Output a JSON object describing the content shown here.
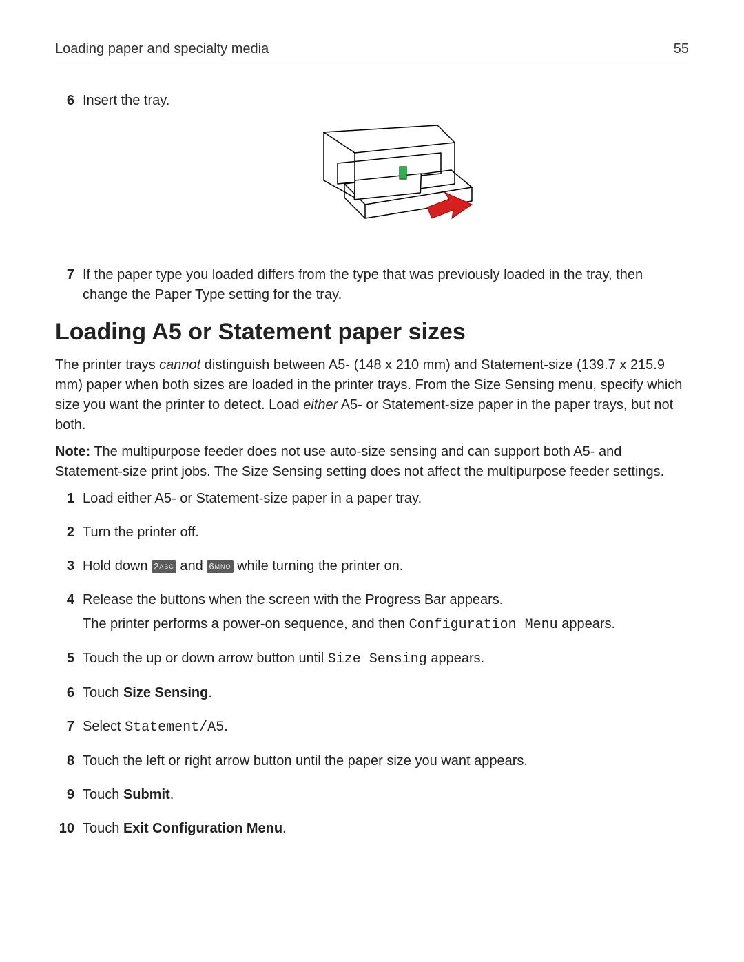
{
  "header": {
    "title": "Loading paper and specialty media",
    "page_number": "55"
  },
  "top_steps": {
    "s6": {
      "num": "6",
      "text": "Insert the tray."
    },
    "s7": {
      "num": "7",
      "text": "If the paper type you loaded differs from the type that was previously loaded in the tray, then change the Paper Type setting for the tray."
    }
  },
  "section": {
    "heading": "Loading A5 or Statement paper sizes",
    "p1_a": "The printer trays ",
    "p1_cannot": "cannot",
    "p1_b": " distinguish between A5‑ (148 x 210 mm) and Statement‑size (139.7 x 215.9 mm) paper when both sizes are loaded in the printer trays. From the Size Sensing menu, specify which size you want the printer to detect. Load ",
    "p1_either": "either",
    "p1_c": " A5‑ or Statement‑size paper in the paper trays, but not both.",
    "note_label": "Note:",
    "note_text": " The multipurpose feeder does not use auto‑size sensing and can support both A5‑ and Statement‑size print jobs. The Size Sensing setting does not affect the multipurpose feeder settings."
  },
  "steps": {
    "s1": {
      "num": "1",
      "text": "Load either A5‑ or Statement‑size paper in a paper tray."
    },
    "s2": {
      "num": "2",
      "text": "Turn the printer off."
    },
    "s3": {
      "num": "3",
      "pre": "Hold down ",
      "key1_main": "2",
      "key1_sup": "ABC",
      "mid": " and ",
      "key2_main": "6",
      "key2_sup": "MNO",
      "post": " while turning the printer on."
    },
    "s4": {
      "num": "4",
      "line1": "Release the buttons when the screen with the Progress Bar appears.",
      "line2_a": "The printer performs a power‑on sequence, and then ",
      "line2_code": "Configuration Menu",
      "line2_b": " appears."
    },
    "s5": {
      "num": "5",
      "a": "Touch the up or down arrow button until ",
      "code": "Size Sensing",
      "b": " appears."
    },
    "s6": {
      "num": "6",
      "a": "Touch ",
      "bold": "Size Sensing",
      "b": "."
    },
    "s7": {
      "num": "7",
      "a": "Select ",
      "code": "Statement/A5",
      "b": "."
    },
    "s8": {
      "num": "8",
      "text": "Touch the left or right arrow button until the paper size you want appears."
    },
    "s9": {
      "num": "9",
      "a": "Touch ",
      "bold": "Submit",
      "b": "."
    },
    "s10": {
      "num": "10",
      "a": "Touch ",
      "bold": "Exit Configuration Menu",
      "b": "."
    }
  }
}
